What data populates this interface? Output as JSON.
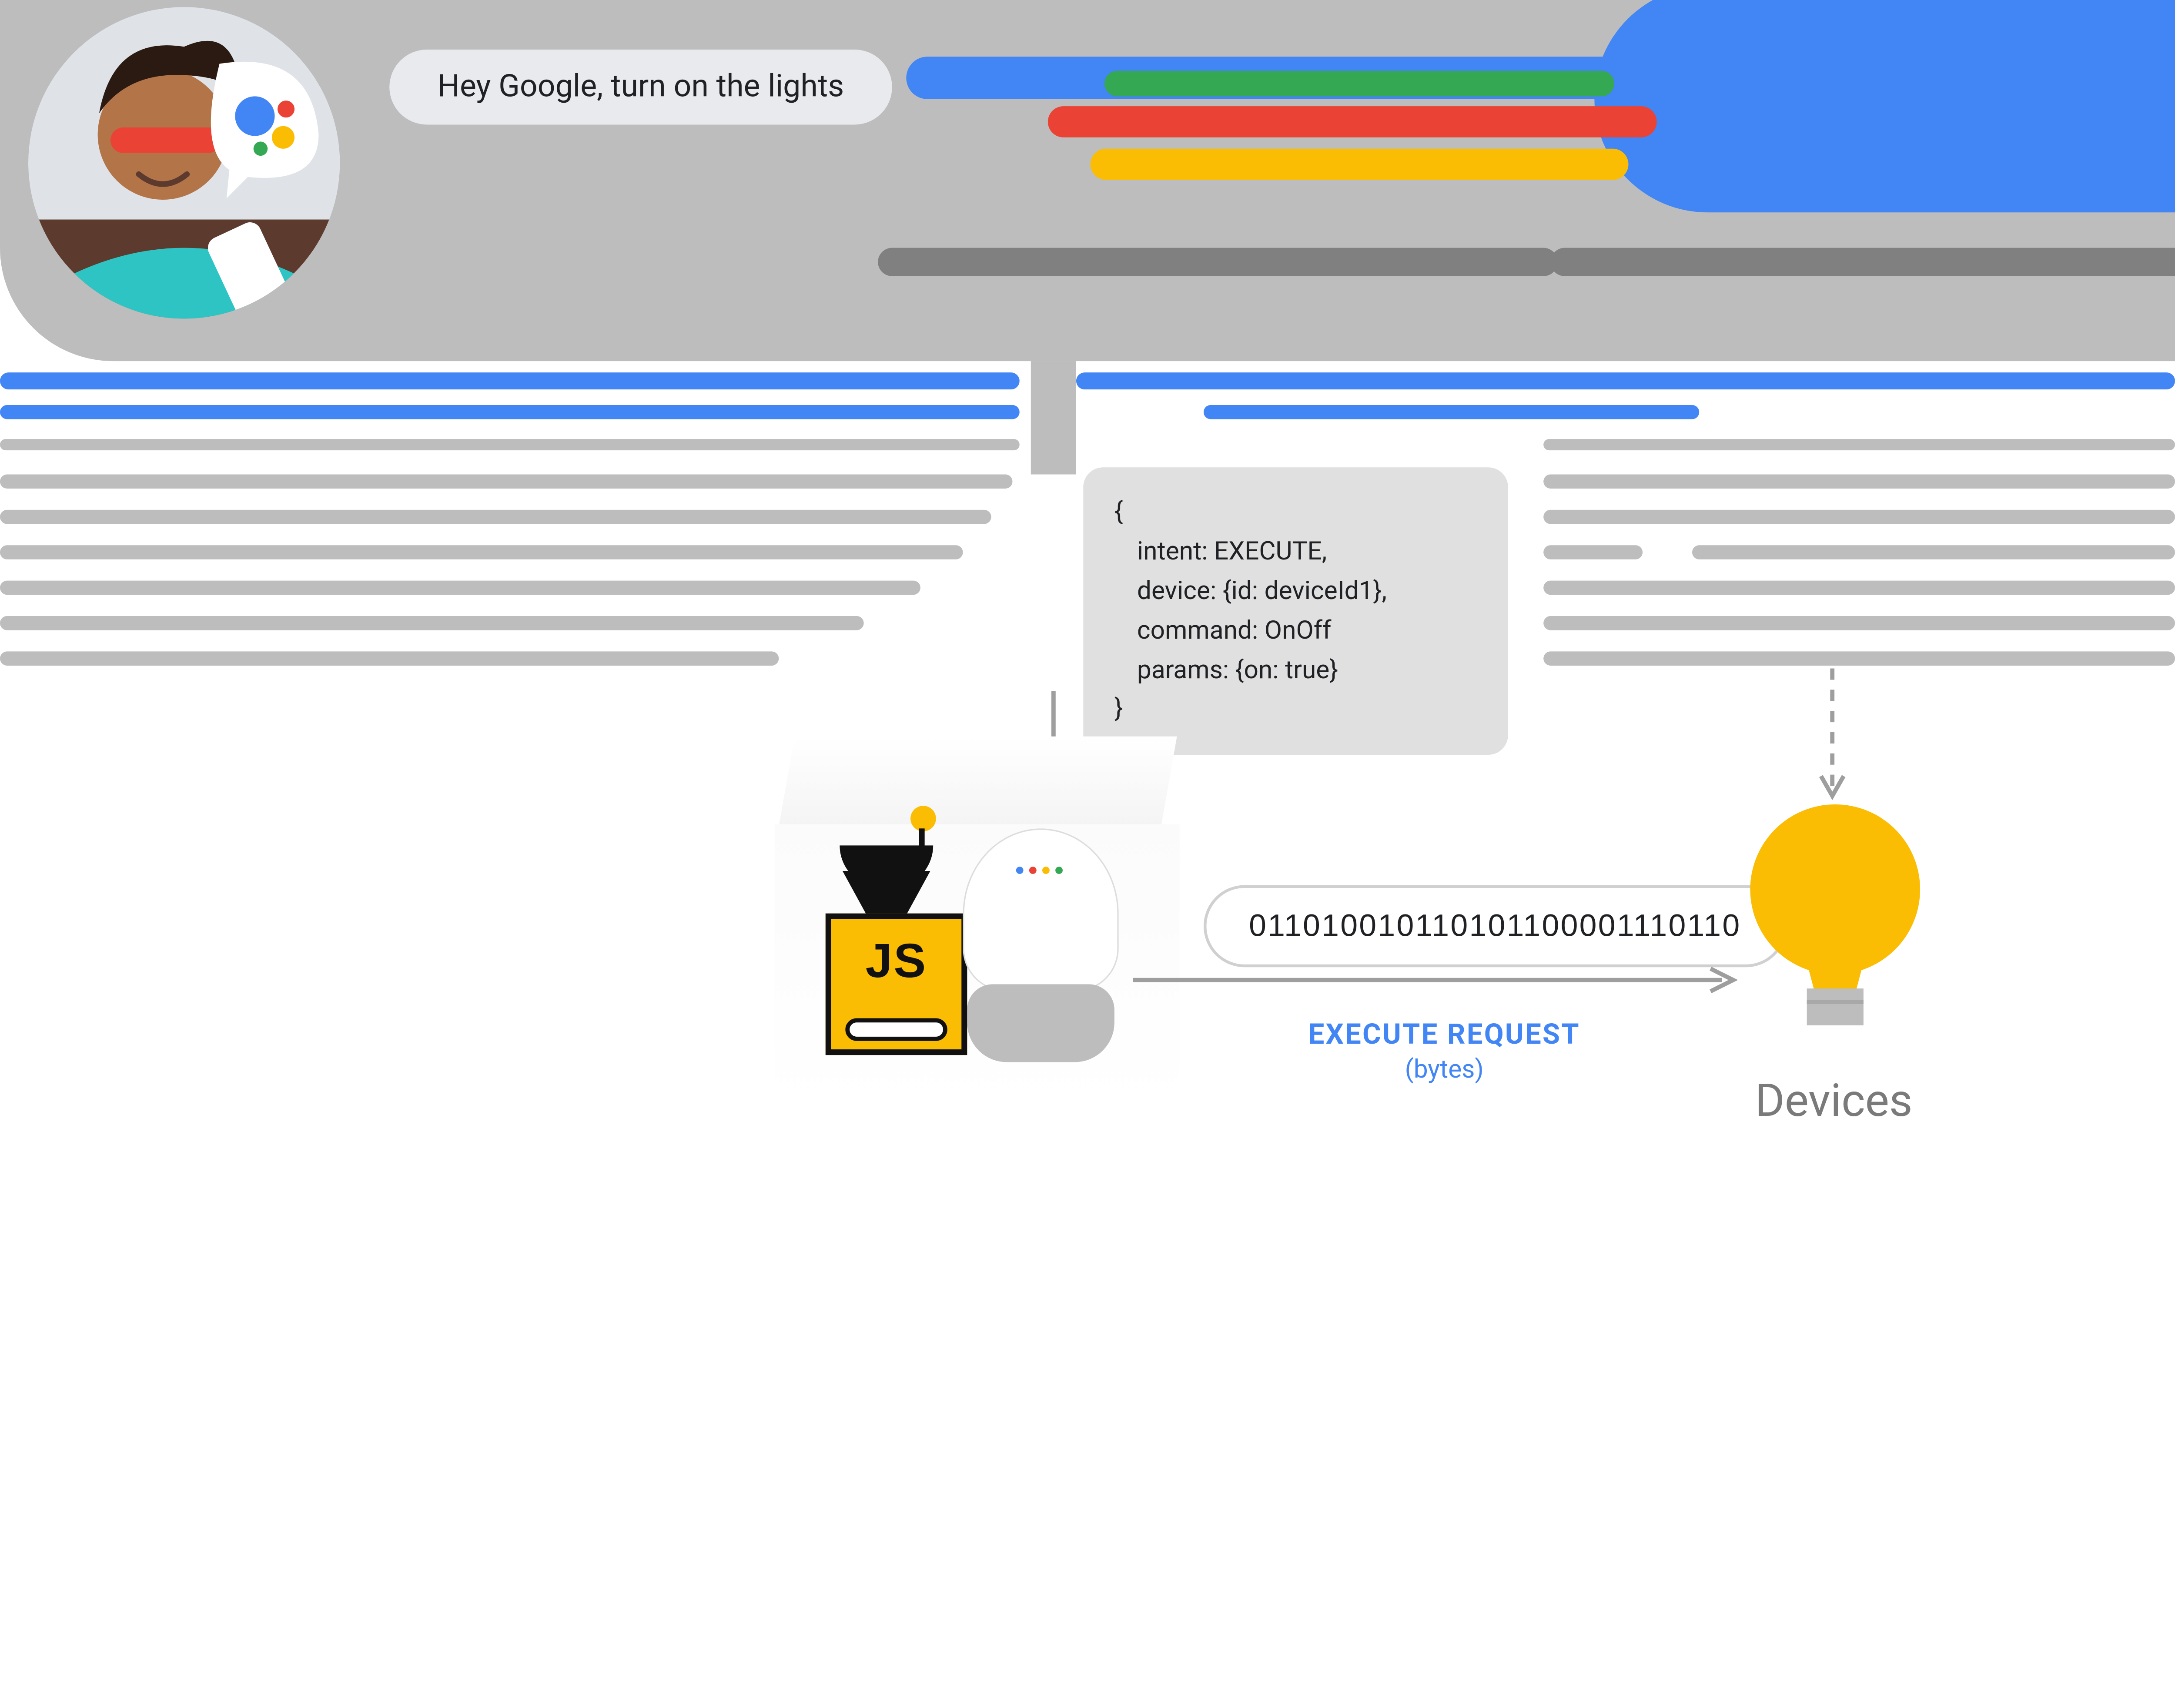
{
  "speech_bubble": "Hey Google, turn on the lights",
  "payload": {
    "open": "{",
    "l1": "intent: EXECUTE,",
    "l2": "device: {id: deviceId1},",
    "l3": "command: OnOff",
    "l4": "params: {on: true}",
    "close": "}"
  },
  "js_label": "JS",
  "binary_stream": "011010010110101100001110110",
  "execute": {
    "title": "EXECUTE REQUEST",
    "subtitle": "(bytes)"
  },
  "devices_label": "Devices",
  "colors": {
    "google_blue": "#4285f4",
    "google_red": "#ea4335",
    "google_yellow": "#fbbc04",
    "google_green": "#34a853",
    "grey": "#bdbdbd"
  }
}
